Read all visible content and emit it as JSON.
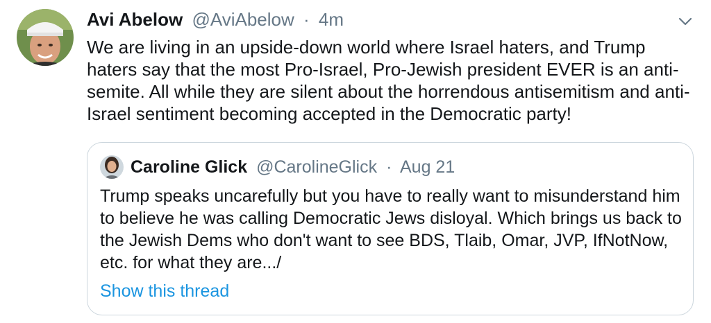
{
  "tweet": {
    "author_name": "Avi Abelow",
    "author_handle": "@AviAbelow",
    "separator": "·",
    "timestamp": "4m",
    "text": "We are living in an upside-down world where Israel haters, and Trump haters say that the most Pro-Israel, Pro-Jewish president EVER is an anti-semite. All while they are silent about the horrendous antisemitism and anti-Israel sentiment becoming accepted in the Democratic party!",
    "menu_icon": "chevron-down-icon"
  },
  "quoted_tweet": {
    "author_name": "Caroline Glick",
    "author_handle": "@CarolineGlick",
    "separator": "·",
    "timestamp": "Aug 21",
    "text": "Trump speaks uncarefully but you have to really want to misunderstand him to believe he was calling Democratic Jews disloyal. Which brings us back to the Jewish Dems who don't want to see BDS, Tlaib, Omar, JVP, IfNotNow, etc. for what they are.../",
    "show_thread_label": "Show this thread"
  },
  "colors": {
    "text_primary": "#14171a",
    "text_secondary": "#657786",
    "link": "#1b95e0",
    "border": "#ccd6dd"
  }
}
